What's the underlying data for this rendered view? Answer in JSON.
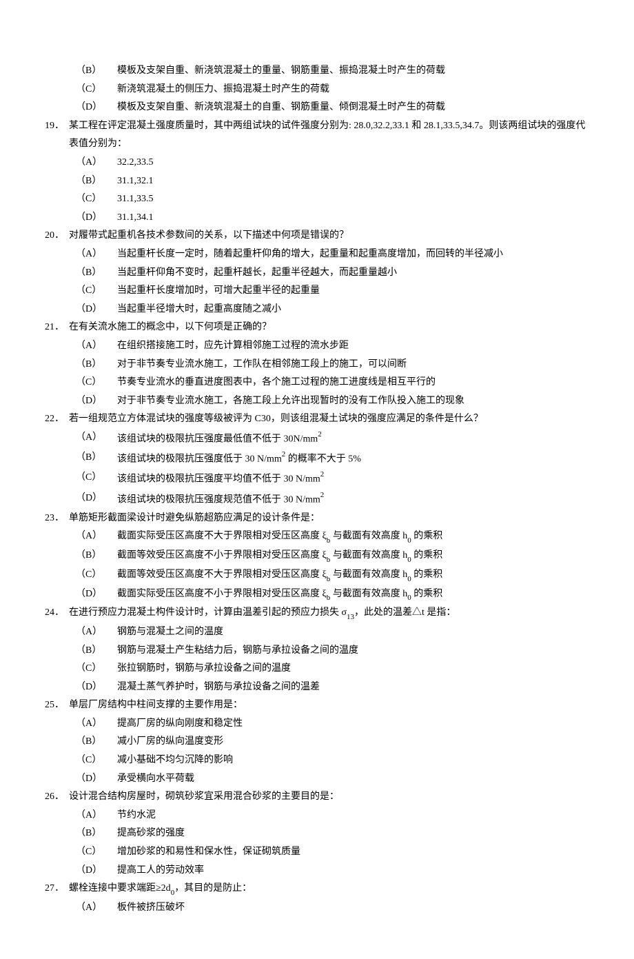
{
  "orphan_options": [
    {
      "label": "（B）",
      "text": "模板及支架自重、新浇筑混凝土的重量、钢筋重量、振捣混凝土时产生的荷载"
    },
    {
      "label": "（C）",
      "text": "新浇筑混凝土的侧压力、振捣混凝土时产生的荷载"
    },
    {
      "label": "（D）",
      "text": "模板及支架自重、新浇筑混凝土的自重、钢筋重量、倾倒混凝土时产生的荷载"
    }
  ],
  "questions": [
    {
      "num": "19．",
      "text": "某工程在评定混凝土强度质量时，其中两组试块的试件强度分别为: 28.0,32.2,33.1 和 28.1,33.5,34.7。则该两组试块的强度代表值分别为：",
      "options": [
        {
          "label": "（A）",
          "text": "32.2,33.5"
        },
        {
          "label": "（B）",
          "text": "31.1,32.1"
        },
        {
          "label": "（C）",
          "text": "31.1,33.5"
        },
        {
          "label": "（D）",
          "text": "31.1,34.1"
        }
      ]
    },
    {
      "num": "20．",
      "text": "对履带式起重机各技术参数间的关系，以下描述中何项是错误的？",
      "options": [
        {
          "label": "（A）",
          "text": "当起重杆长度一定时，随着起重杆仰角的增大，起重量和起重高度增加，而回转的半径减小"
        },
        {
          "label": "（B）",
          "text": "当起重杆仰角不变时，起重杆越长，起重半径越大，而起重量越小"
        },
        {
          "label": "（C）",
          "text": "当起重杆长度增加时，可增大起重半径的起重量"
        },
        {
          "label": "（D）",
          "text": "当起重半径增大时，起重高度随之减小"
        }
      ]
    },
    {
      "num": "21．",
      "text": "在有关流水施工的概念中，以下何项是正确的？",
      "options": [
        {
          "label": "（A）",
          "text": "在组织搭接施工时，应先计算相邻施工过程的流水步距"
        },
        {
          "label": "（B）",
          "text": "对于非节奏专业流水施工，工作队在相邻施工段上的施工，可以间断"
        },
        {
          "label": "（C）",
          "text": "节奏专业流水的垂直进度图表中，各个施工过程的施工进度线是相互平行的"
        },
        {
          "label": "（D）",
          "text": "对于非节奏专业流水施工，各施工段上允许出现暂时的没有工作队投入施工的现象"
        }
      ]
    },
    {
      "num": "22．",
      "text": "若一组规范立方体混试块的强度等级被评为 C30，则该组混凝土试块的强度应满足的条件是什么？",
      "options": [
        {
          "label": "（A）",
          "html": "该组试块的极限抗压强度最低值不低于 30N/mm<span class='sup'>2</span>"
        },
        {
          "label": "（B）",
          "html": "该组试块的极限抗压强度低于 30 N/mm<span class='sup'>2</span> 的概率不大于 5%"
        },
        {
          "label": "（C）",
          "html": "该组试块的极限抗压强度平均值不低于 30 N/mm<span class='sup'>2</span>"
        },
        {
          "label": "（D）",
          "html": "该组试块的极限抗压强度规范值不低于 30 N/mm<span class='sup'>2</span>"
        }
      ]
    },
    {
      "num": "23．",
      "text": "单筋矩形截面梁设计时避免纵筋超筋应满足的设计条件是：",
      "options": [
        {
          "label": "（A）",
          "html": "截面实际受压区高度不大于界限相对受压区高度 ξ<span class='sub'>b</span> 与截面有效高度 h<span class='sub'>0</span> 的乘积"
        },
        {
          "label": "（B）",
          "html": "截面等效受压区高度不小于界限相对受压区高度 ξ<span class='sub'>b</span> 与截面有效高度 h<span class='sub'>0</span> 的乘积"
        },
        {
          "label": "（C）",
          "html": "截面等效受压区高度不大于界限相对受压区高度 ξ<span class='sub'>b</span> 与截面有效高度 h<span class='sub'>0</span> 的乘积"
        },
        {
          "label": "（D）",
          "html": "截面实际受压区高度不小于界限相对受压区高度 ξ<span class='sub'>b</span> 与截面有效高度 h<span class='sub'>0</span> 的乘积"
        }
      ]
    },
    {
      "num": "24．",
      "html": "在进行预应力混凝土构件设计时，计算由温差引起的预应力损失 σ<span class='sub'>13</span>，此处的温差△t 是指：",
      "options": [
        {
          "label": "（A）",
          "text": "钢筋与混凝土之间的温度"
        },
        {
          "label": "（B）",
          "text": "钢筋与混凝土产生粘结力后，钢筋与承拉设备之间的温度"
        },
        {
          "label": "（C）",
          "text": "张拉钢筋时，钢筋与承拉设备之间的温度"
        },
        {
          "label": "（D）",
          "text": "混凝土蒸气养护时，钢筋与承拉设备之间的温差"
        }
      ]
    },
    {
      "num": "25．",
      "text": "单层厂房结构中柱间支撑的主要作用是：",
      "options": [
        {
          "label": "（A）",
          "text": "提高厂房的纵向刚度和稳定性"
        },
        {
          "label": "（B）",
          "text": "减小厂房的纵向温度变形"
        },
        {
          "label": "（C）",
          "text": "减小基础不均匀沉降的影响"
        },
        {
          "label": "（D）",
          "text": "承受横向水平荷载"
        }
      ]
    },
    {
      "num": "26．",
      "text": "设计混合结构房屋时，砌筑砂浆宜采用混合砂浆的主要目的是：",
      "options": [
        {
          "label": "（A）",
          "text": "节约水泥"
        },
        {
          "label": "（B）",
          "text": "提高砂浆的强度"
        },
        {
          "label": "（C）",
          "text": "增加砂浆的和易性和保水性，保证砌筑质量"
        },
        {
          "label": "（D）",
          "text": "提高工人的劳动效率"
        }
      ]
    },
    {
      "num": "27．",
      "html": "螺栓连接中要求端距≥2d<span class='sub'>0</span>，其目的是防止：",
      "options": [
        {
          "label": "（A）",
          "text": "板件被挤压破坏"
        }
      ]
    }
  ]
}
